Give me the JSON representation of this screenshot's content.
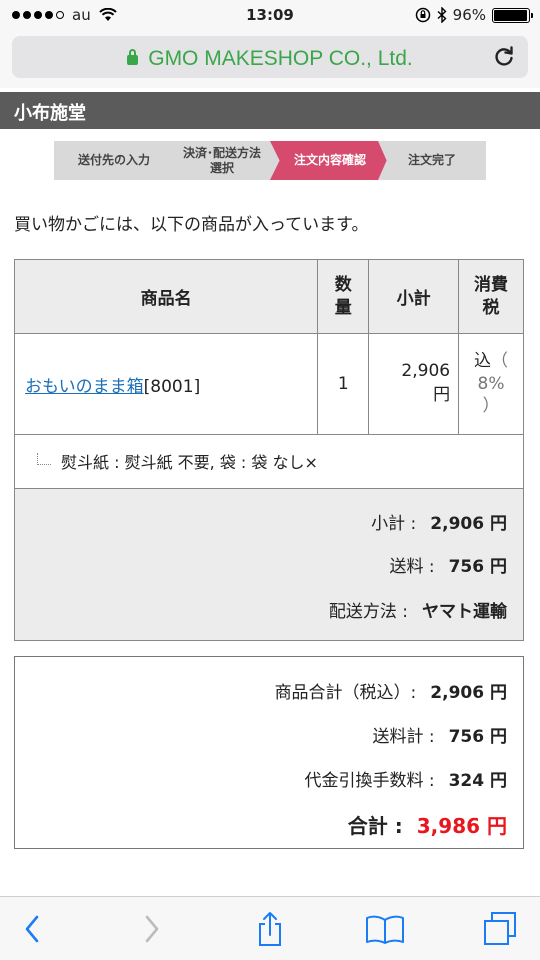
{
  "status_bar": {
    "carrier": "au",
    "time": "13:09",
    "battery": "96%",
    "battery_level": 0.96,
    "icons": [
      "signal-dots-icon",
      "wifi-icon",
      "orientation-lock-icon",
      "bluetooth-icon",
      "battery-icon"
    ]
  },
  "address_bar": {
    "site": "GMO MAKESHOP CO., Ltd.",
    "secure_icon": "lock-icon",
    "reload_icon": "reload-icon",
    "accent": "#3aa64a"
  },
  "shop": {
    "name": "小布施堂"
  },
  "steps": [
    {
      "label": "送付先の入力",
      "active": false
    },
    {
      "label": "決済･配送方法\n選択",
      "active": false
    },
    {
      "label": "注文内容確認",
      "active": true
    },
    {
      "label": "注文完了",
      "active": false
    }
  ],
  "step_colors": {
    "active": "#d54a6d",
    "inactive": "#d9d9d9"
  },
  "intro_text": "買い物かごには、以下の商品が入っています。",
  "table": {
    "headers": {
      "name": "商品名",
      "qty": "数\n量",
      "subtotal": "小計",
      "tax": "消費\n税"
    },
    "rows": [
      {
        "name": "おもいのまま箱",
        "code": "[8001]",
        "qty": "1",
        "subtotal": "2,906",
        "subtotal_unit": "円",
        "tax_kind": "込",
        "tax_open": "（",
        "tax_rate": "8%",
        "tax_close": "）"
      }
    ],
    "option_text": "熨斗紙 : 熨斗紙 不要, 袋 : 袋 なし×"
  },
  "subtotals": [
    {
      "label": "小計 :",
      "value": "2,906 円"
    },
    {
      "label": "送料 :",
      "value": "756 円"
    },
    {
      "label": "配送方法 :",
      "value": "ヤマト運輸"
    }
  ],
  "totals": [
    {
      "label": "商品合計（税込）:",
      "value": "2,906 円"
    },
    {
      "label": "送料計 :",
      "value": "756 円"
    },
    {
      "label": "代金引換手数料 :",
      "value": "324 円"
    }
  ],
  "grand_total": {
    "label": "合計 :",
    "value": "3,986 円",
    "color": "#e8161d"
  },
  "toolbar": {
    "icons": [
      "back-icon",
      "forward-icon",
      "share-icon",
      "bookmarks-icon",
      "tabs-icon"
    ],
    "accent": "#1a7cf6"
  }
}
